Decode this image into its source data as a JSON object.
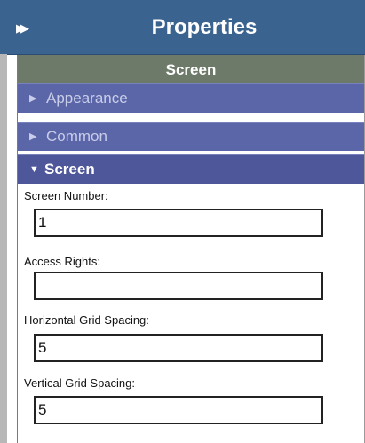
{
  "header": {
    "collapse_icon": "double-chevron-right-icon",
    "title": "Properties"
  },
  "group": {
    "title": "Screen"
  },
  "sections": [
    {
      "label": "Appearance",
      "expanded": false
    },
    {
      "label": "Common",
      "expanded": false
    },
    {
      "label": "Screen",
      "expanded": true
    }
  ],
  "fields": [
    {
      "label": "Screen Number:",
      "value": "1"
    },
    {
      "label": "Access Rights:",
      "value": ""
    },
    {
      "label": "Horizontal Grid Spacing:",
      "value": "5"
    },
    {
      "label": "Vertical Grid Spacing:",
      "value": "5"
    }
  ],
  "colors": {
    "titlebar": "#3a6390",
    "group_header": "#6d7a6a",
    "section_collapsed": "#5b66a8",
    "section_expanded": "#4d5799"
  }
}
